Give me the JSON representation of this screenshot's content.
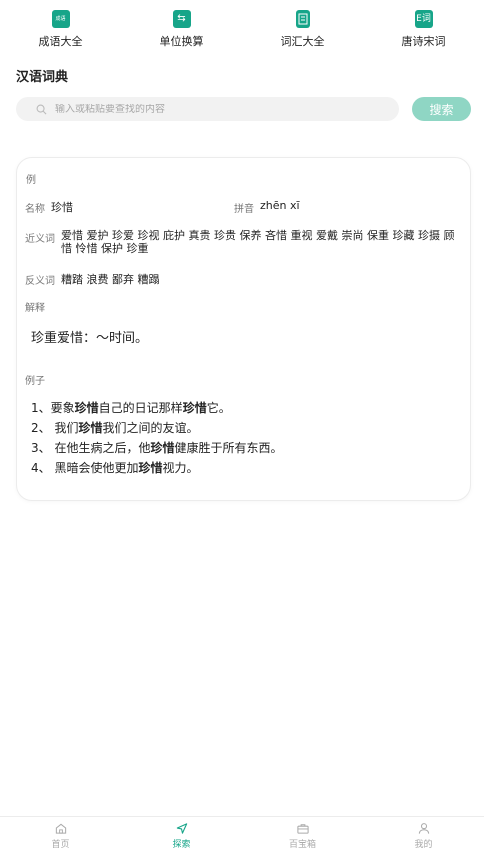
{
  "tools": [
    {
      "label": "成语大全",
      "icon_text": "成语",
      "icon": "idiom-book-icon"
    },
    {
      "label": "单位换算",
      "icon_text": "⇆",
      "icon": "unit-convert-icon"
    },
    {
      "label": "词汇大全",
      "icon_text": "",
      "icon": "vocabulary-book-icon"
    },
    {
      "label": "唐诗宋词",
      "icon_text": "E词",
      "icon": "poetry-icon"
    }
  ],
  "page_title": "汉语词典",
  "search": {
    "placeholder": "输入或粘贴要查找的内容",
    "button_label": "搜索"
  },
  "entry": {
    "example_tag": "例",
    "name_label": "名称",
    "name_value": "珍惜",
    "pinyin_label": "拼音",
    "pinyin_value": "zhēn xī",
    "synonyms_label": "近义词",
    "synonyms_line1": "爱惜 爱护 珍爱 珍视 庇护 真贵 珍贵 保养 吝惜 重视 爱戴 崇尚 保重 珍藏 珍摄 顾",
    "synonyms_line2": "惜 怜惜 保护 珍重",
    "antonyms_label": "反义词",
    "antonyms_value": "糟踏 浪费 鄙弃 糟蹋",
    "explanation_label": "解释",
    "explanation_text": "珍重爱惜：～时间。",
    "examples_label": "例子",
    "examples": [
      {
        "num": "1、",
        "pre": "要象",
        "bold1": "珍惜",
        "mid": "自己的日记那样",
        "bold2": "珍惜",
        "post": "它。"
      },
      {
        "num": "2、",
        "pre": " 我们",
        "bold1": "珍惜",
        "mid": "我们之间的友谊。",
        "bold2": "",
        "post": ""
      },
      {
        "num": "3、",
        "pre": " 在他生病之后，他",
        "bold1": "珍惜",
        "mid": "健康胜于所有东西。",
        "bold2": "",
        "post": ""
      },
      {
        "num": "4、",
        "pre": " 黑暗会使他更加",
        "bold1": "珍惜",
        "mid": "视力。",
        "bold2": "",
        "post": ""
      }
    ]
  },
  "bottom_nav": [
    {
      "label": "首页",
      "icon": "home-icon",
      "active": false
    },
    {
      "label": "探索",
      "icon": "navigate-icon",
      "active": true
    },
    {
      "label": "百宝箱",
      "icon": "toolbox-icon",
      "active": false
    },
    {
      "label": "我的",
      "icon": "user-icon",
      "active": false
    }
  ],
  "colors": {
    "accent": "#17a589",
    "search_button": "#8fd6c4"
  }
}
